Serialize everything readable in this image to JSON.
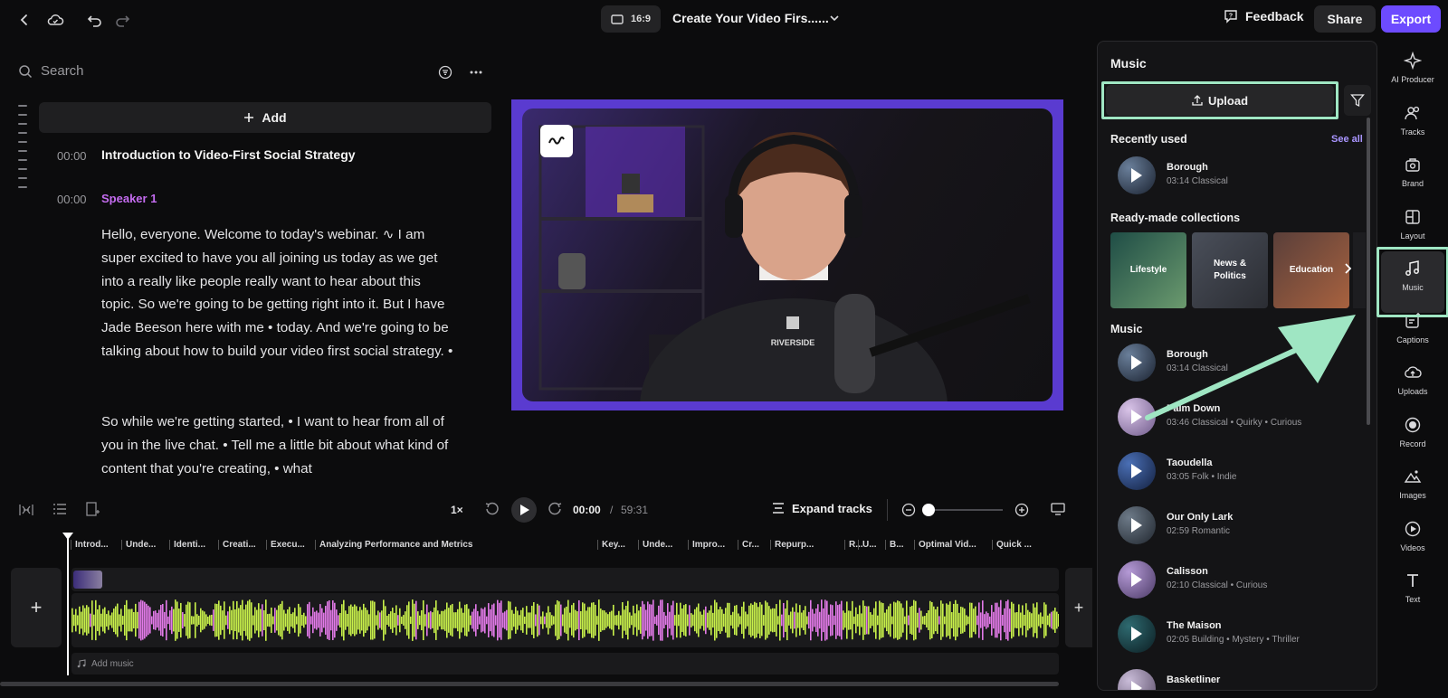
{
  "topbar": {
    "ratio": "16:9",
    "project_title": "Create Your Video Firs......",
    "feedback": "Feedback",
    "share": "Share",
    "export": "Export"
  },
  "transcript": {
    "search_placeholder": "Search",
    "add_label": "Add",
    "chapter_time": "00:00",
    "chapter_title": "Introduction to Video-First Social Strategy",
    "speaker_time": "00:00",
    "speaker": "Speaker 1",
    "paragraph1": "Hello, everyone. Welcome to today's webinar. ∿ I am super excited to have you all joining us today as we get into a really like people really want to hear about this topic. So we're going to be getting right into it. But I have Jade Beeson here with me • today. And we're going to be talking about how to build your video first social strategy. •",
    "paragraph2": "So while we're getting started, • I want to hear from all of you in the live chat. • Tell me a little bit about what kind of content that you're creating, • what"
  },
  "preview": {
    "shirt_text": "RIVERSIDE"
  },
  "playback": {
    "speed": "1×",
    "current_time": "00:00",
    "separator": "/",
    "total_time": "59:31",
    "expand_tracks": "Expand tracks",
    "zoom_level": 0.05
  },
  "timeline": {
    "chapters": [
      "Introd...",
      "Unde...",
      "Identi...",
      "Creati...",
      "Execu...",
      "Analyzing Performance and Metrics",
      "Key...",
      "Unde...",
      "Impro...",
      "Cr...",
      "Repurp...",
      "R...",
      "U...",
      "B...",
      "Optimal Vid...",
      "Quick ..."
    ],
    "add_music": "Add music"
  },
  "music_panel": {
    "title": "Music",
    "upload": "Upload",
    "recently_used": "Recently used",
    "see_all": "See all",
    "recent": [
      {
        "name": "Borough",
        "meta": "03:14 Classical"
      }
    ],
    "collections_title": "Ready-made collections",
    "collections": [
      {
        "label": "Lifestyle"
      },
      {
        "label": "News &\nPolitics"
      },
      {
        "label": "Education"
      }
    ],
    "music_title": "Music",
    "tracks": [
      {
        "name": "Borough",
        "meta": "03:14 Classical"
      },
      {
        "name": "Palm Down",
        "meta": "03:46 Classical • Quirky • Curious"
      },
      {
        "name": "Taoudella",
        "meta": "03:05 Folk • Indie"
      },
      {
        "name": "Our Only Lark",
        "meta": "02:59 Romantic"
      },
      {
        "name": "Calisson",
        "meta": "02:10 Classical • Curious"
      },
      {
        "name": "The Maison",
        "meta": "02:05 Building • Mystery • Thriller"
      },
      {
        "name": "Basketliner",
        "meta": ""
      }
    ]
  },
  "rail": {
    "items": [
      "AI Producer",
      "Tracks",
      "Brand",
      "Layout",
      "Music",
      "Captions",
      "Uploads",
      "Record",
      "Images",
      "Videos",
      "Text"
    ]
  },
  "colors": {
    "accent": "#6d4bff",
    "highlight": "#9fe6c3",
    "wave_green": "#c8f04a",
    "wave_pink": "#e27ae8"
  }
}
